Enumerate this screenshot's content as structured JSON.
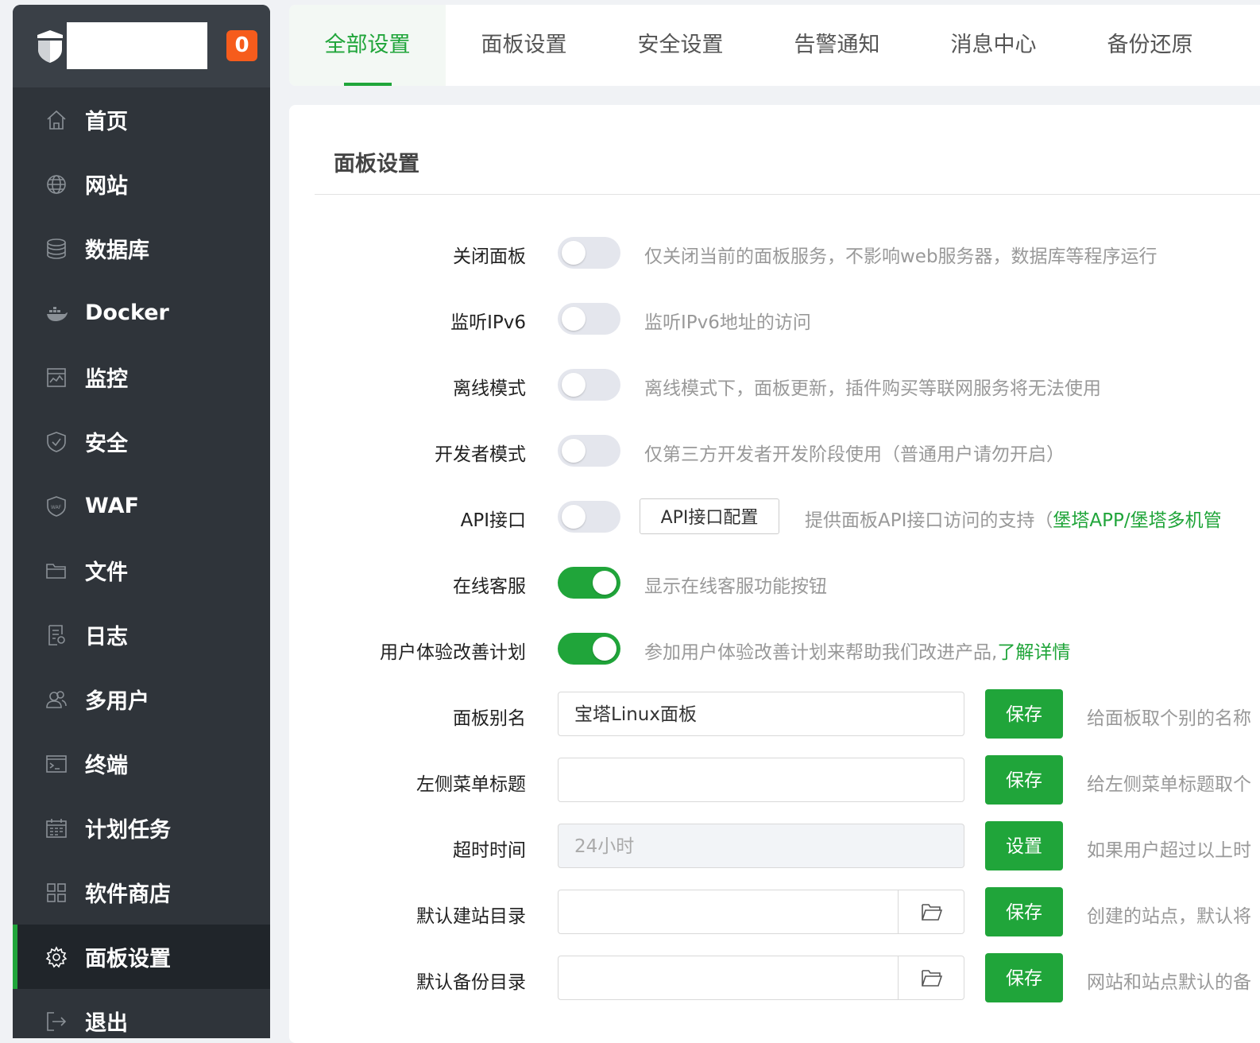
{
  "sidebar": {
    "badge": "0",
    "items": [
      {
        "label": "首页",
        "icon": "home-icon"
      },
      {
        "label": "网站",
        "icon": "globe-icon"
      },
      {
        "label": "数据库",
        "icon": "database-icon"
      },
      {
        "label": "Docker",
        "icon": "docker-icon"
      },
      {
        "label": "监控",
        "icon": "monitor-icon"
      },
      {
        "label": "安全",
        "icon": "shield-check-icon"
      },
      {
        "label": "WAF",
        "icon": "waf-shield-icon"
      },
      {
        "label": "文件",
        "icon": "folder-icon"
      },
      {
        "label": "日志",
        "icon": "log-icon"
      },
      {
        "label": "多用户",
        "icon": "users-icon"
      },
      {
        "label": "终端",
        "icon": "terminal-icon"
      },
      {
        "label": "计划任务",
        "icon": "calendar-icon"
      },
      {
        "label": "软件商店",
        "icon": "grid-icon"
      },
      {
        "label": "面板设置",
        "icon": "gear-icon",
        "active": true
      },
      {
        "label": "退出",
        "icon": "logout-icon"
      }
    ]
  },
  "tabs": [
    "全部设置",
    "面板设置",
    "安全设置",
    "告警通知",
    "消息中心",
    "备份还原"
  ],
  "active_tab": "全部设置",
  "panel": {
    "title": "面板设置",
    "toggles": [
      {
        "label": "关闭面板",
        "on": false,
        "desc": "仅关闭当前的面板服务，不影响web服务器，数据库等程序运行"
      },
      {
        "label": "监听IPv6",
        "on": false,
        "desc": "监听IPv6地址的访问"
      },
      {
        "label": "离线模式",
        "on": false,
        "desc": "离线模式下，面板更新，插件购买等联网服务将无法使用"
      },
      {
        "label": "开发者模式",
        "on": false,
        "desc": "仅第三方开发者开发阶段使用（普通用户请勿开启）"
      },
      {
        "label": "API接口",
        "on": false,
        "button": "API接口配置",
        "desc": "提供面板API接口访问的支持（",
        "link1": "堡塔APP",
        "sep": "/",
        "link2": "堡塔多机管"
      },
      {
        "label": "在线客服",
        "on": true,
        "desc": "显示在线客服功能按钮"
      },
      {
        "label": "用户体验改善计划",
        "on": true,
        "desc": "参加用户体验改善计划来帮助我们改进产品,",
        "link": "了解详情"
      }
    ],
    "fields": [
      {
        "label": "面板别名",
        "value": "宝塔Linux面板",
        "button": "保存",
        "desc": "给面板取个别的名称"
      },
      {
        "label": "左侧菜单标题",
        "value": "",
        "button": "保存",
        "desc": "给左侧菜单标题取个"
      },
      {
        "label": "超时时间",
        "value": "24小时",
        "button": "设置",
        "desc": "如果用户超过以上时"
      },
      {
        "label": "默认建站目录",
        "value": "",
        "button": "保存",
        "desc": "创建的站点，默认将"
      },
      {
        "label": "默认备份目录",
        "value": "",
        "button": "保存",
        "desc": "网站和站点默认的备"
      }
    ]
  },
  "colors": {
    "accent": "#20a53a",
    "sidebar_bg": "#2f343a",
    "badge": "#f65c1c"
  }
}
